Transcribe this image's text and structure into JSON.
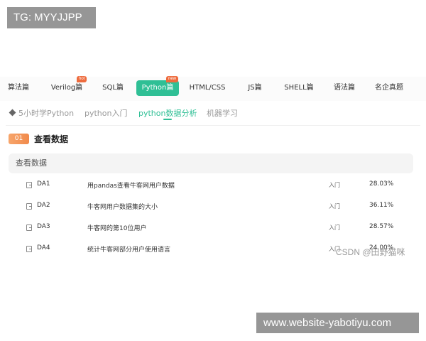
{
  "watermark_top": "TG: MYYJJPP",
  "watermark_bottom": "www.website-yabotiyu.com",
  "csdn_watermark": "CSDN @田野猫咪",
  "nav": {
    "tabs": [
      {
        "label": "算法篇"
      },
      {
        "label": "Verilog篇",
        "badge": "hot"
      },
      {
        "label": "SQL篇"
      },
      {
        "label": "Python篇",
        "badge": "new",
        "active": true
      },
      {
        "label": "HTML/CSS"
      },
      {
        "label": "JS篇"
      },
      {
        "label": "SHELL篇"
      },
      {
        "label": "语法篇"
      },
      {
        "label": "名企真题"
      }
    ]
  },
  "subnav": {
    "items": [
      {
        "label": "5小时学Python"
      },
      {
        "label": "python入门"
      },
      {
        "label": "python数据分析",
        "active": true
      },
      {
        "label": "机器学习"
      }
    ]
  },
  "section": {
    "number": "01",
    "title": "查看数据",
    "list_header": "查看数据",
    "rows": [
      {
        "code": "DA1",
        "title": "用pandas查看牛客网用户数据",
        "level": "入门",
        "rate": "28.03%"
      },
      {
        "code": "DA2",
        "title": "牛客网用户数据集的大小",
        "level": "入门",
        "rate": "36.11%"
      },
      {
        "code": "DA3",
        "title": "牛客网的第10位用户",
        "level": "入门",
        "rate": "28.57%"
      },
      {
        "code": "DA4",
        "title": "统计牛客网部分用户使用语言",
        "level": "入门",
        "rate": "24.00%"
      }
    ]
  },
  "colors": {
    "accent": "#2fbf95",
    "badge": "#ee6b3d",
    "number_badge": "#f18a4b"
  }
}
